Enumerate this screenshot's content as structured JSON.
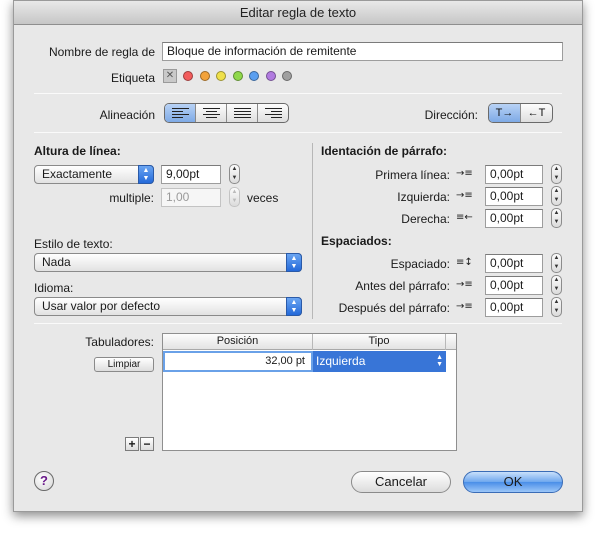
{
  "window": {
    "title": "Editar regla de texto"
  },
  "rule_name": {
    "label": "Nombre de regla de",
    "value": "Bloque de información de remitente"
  },
  "tag": {
    "label": "Etiqueta",
    "clear_glyph": "✕",
    "colors": [
      "#f25c5c",
      "#f2a23a",
      "#efe04a",
      "#8fd84a",
      "#5a9ff0",
      "#b17be0",
      "#a0a0a0"
    ]
  },
  "alignment": {
    "label": "Alineación"
  },
  "direction": {
    "label": "Dirección:",
    "ltr": "T→",
    "rtl": "←T"
  },
  "line_height": {
    "heading": "Altura de línea:",
    "mode": "Exactamente",
    "value": "9,00pt",
    "multiple_label": "multiple:",
    "multiple_value": "1,00",
    "multiple_unit": "veces"
  },
  "indent": {
    "heading": "Identación de párrafo:",
    "rows": [
      {
        "label": "Primera línea:",
        "value": "0,00pt"
      },
      {
        "label": "Izquierda:",
        "value": "0,00pt"
      },
      {
        "label": "Derecha:",
        "value": "0,00pt"
      }
    ]
  },
  "spacing": {
    "heading": "Espaciados:",
    "rows": [
      {
        "label": "Espaciado:",
        "value": "0,00pt"
      },
      {
        "label": "Antes del párrafo:",
        "value": "0,00pt"
      },
      {
        "label": "Después del párrafo:",
        "value": "0,00pt"
      }
    ]
  },
  "text_style": {
    "label": "Estilo de texto:",
    "value": "Nada"
  },
  "language": {
    "label": "Idioma:",
    "value": "Usar valor por defecto"
  },
  "tabs": {
    "label": "Tabuladores:",
    "clear_button": "Limpiar",
    "columns": [
      "Posición",
      "Tipo"
    ],
    "rows": [
      {
        "position": "32,00 pt",
        "type": "Izquierda"
      }
    ],
    "add": "+",
    "remove": "−"
  },
  "buttons": {
    "help": "?",
    "cancel": "Cancelar",
    "ok": "OK"
  }
}
